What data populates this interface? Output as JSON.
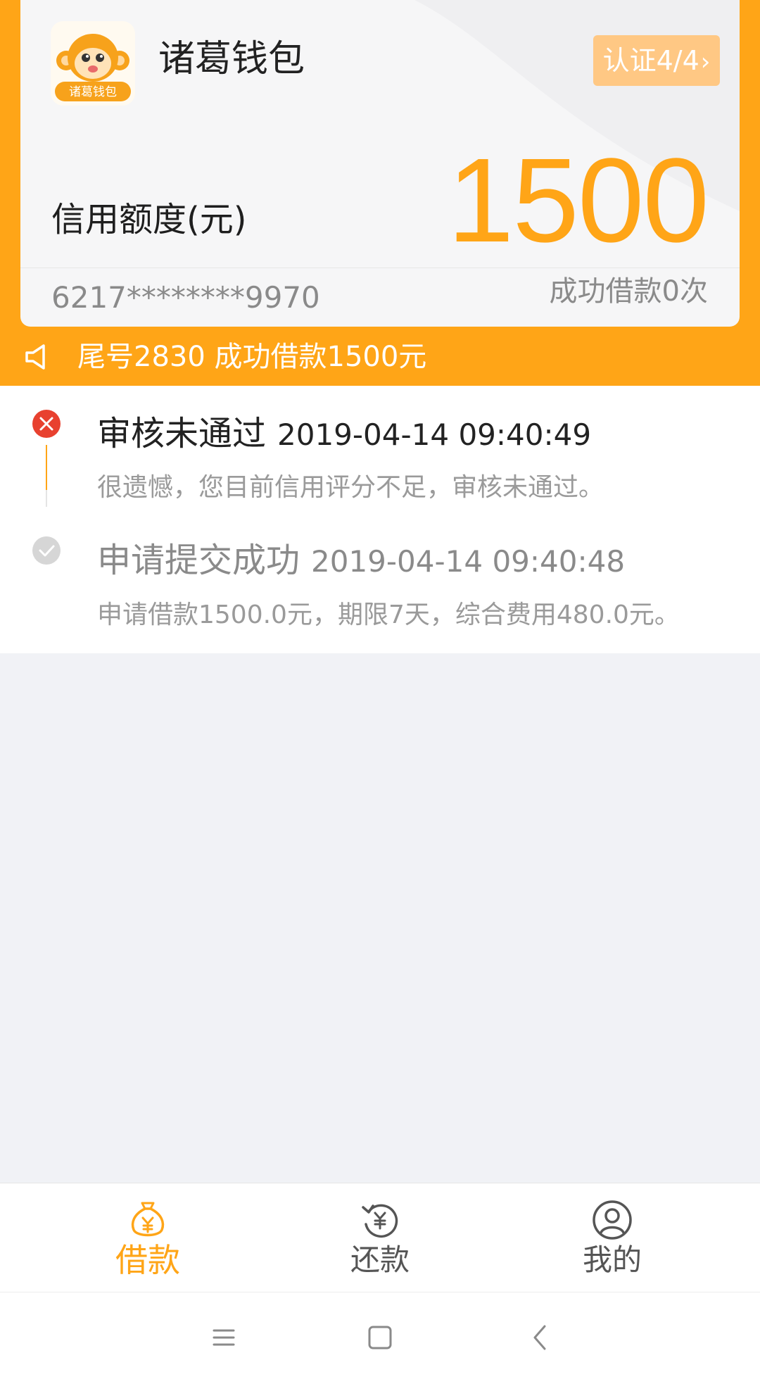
{
  "app": {
    "name": "诸葛钱包",
    "logo_text": "诸葛钱包",
    "brand_color": "#ffa517"
  },
  "card": {
    "certification_label": "认证4/4",
    "credit_label": "信用额度(元)",
    "credit_amount": "1500",
    "card_number": "6217********9970",
    "success_count": "成功借款0次"
  },
  "notice": {
    "icon": "speaker-icon",
    "text": "尾号2830 成功借款1500元"
  },
  "timeline": [
    {
      "status": "审核未通过",
      "time": "2019-04-14 09:40:49",
      "description": "很遗憾，您目前信用评分不足，审核未通过。",
      "icon": "close-circle-icon",
      "color": "#e8412f"
    },
    {
      "status": "申请提交成功",
      "time": "2019-04-14 09:40:48",
      "description": "申请借款1500.0元，期限7天，综合费用480.0元。",
      "icon": "check-circle-icon",
      "color": "#d6d6d6"
    }
  ],
  "tabs": [
    {
      "label": "借款",
      "icon": "money-bag-icon",
      "active": true
    },
    {
      "label": "还款",
      "icon": "repay-icon",
      "active": false
    },
    {
      "label": "我的",
      "icon": "user-icon",
      "active": false
    }
  ],
  "system_nav": [
    "menu-icon",
    "home-icon",
    "back-icon"
  ]
}
